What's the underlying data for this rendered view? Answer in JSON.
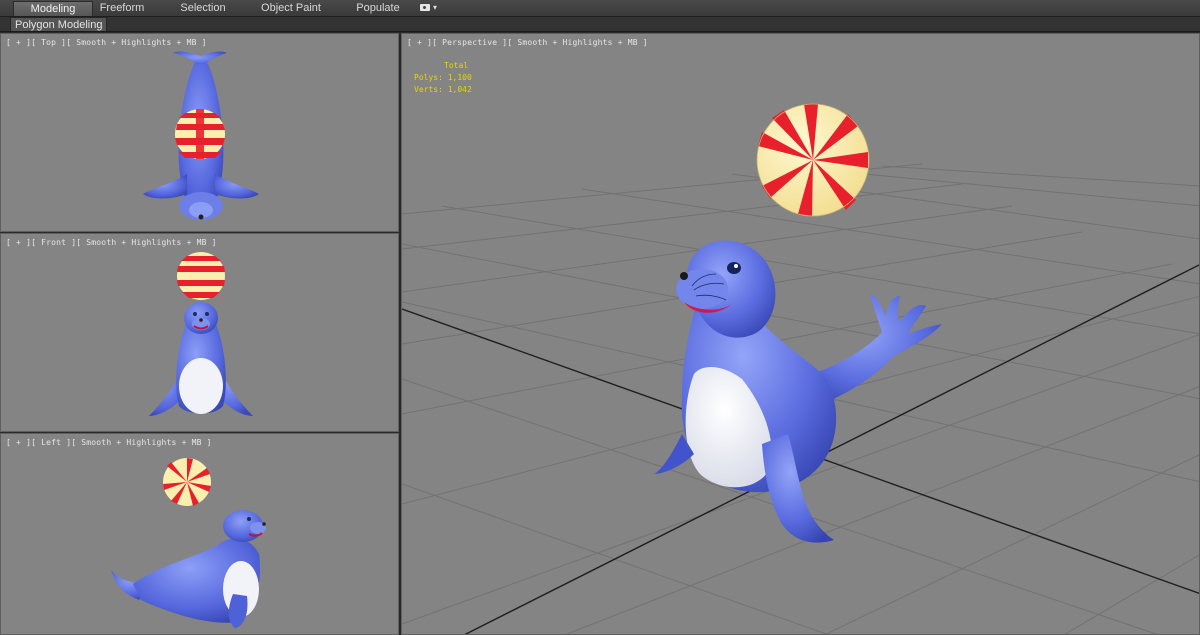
{
  "ribbon": {
    "tabs": [
      {
        "label": "Modeling",
        "active": true
      },
      {
        "label": "Freeform"
      },
      {
        "label": "Selection"
      },
      {
        "label": "Object Paint"
      },
      {
        "label": "Populate"
      }
    ],
    "extra_icon": "camera-icon"
  },
  "subbar": {
    "label": "Polygon Modeling"
  },
  "viewports": {
    "top": {
      "label": "[ + ][ Top ][ Smooth + Highlights + MB ]"
    },
    "front": {
      "label": "[ + ][ Front ][ Smooth + Highlights + MB ]"
    },
    "left": {
      "label": "[ + ][ Left ][ Smooth + Highlights + MB ]"
    },
    "perspective": {
      "label": "[ + ][ Perspective ][ Smooth + Highlights + MB ]",
      "stats": {
        "header": "Total",
        "polys": "Polys: 1,100",
        "verts": "Verts: 1,042"
      }
    }
  },
  "colors": {
    "seal": "#5b6fe0",
    "belly": "#f2f3f8",
    "ball_red": "#e8202c",
    "ball_cream": "#fbefb0",
    "viewport_bg": "#848484",
    "stats_text": "#e6d600"
  }
}
